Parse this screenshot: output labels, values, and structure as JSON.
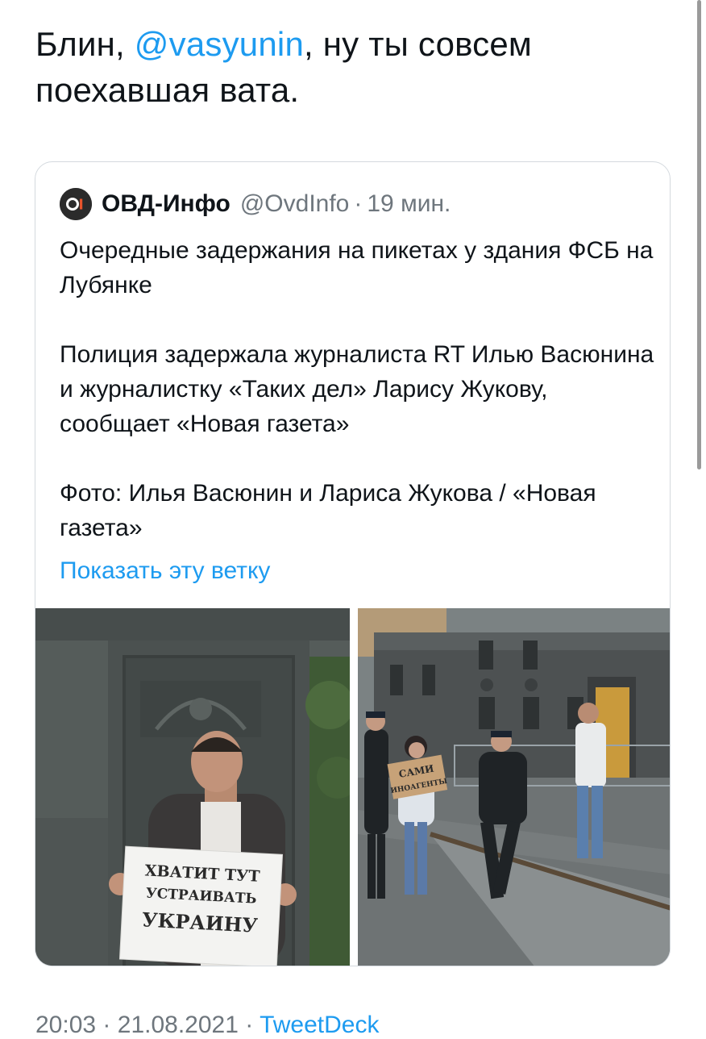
{
  "tweet": {
    "text_before": "Блин, ",
    "mention": "@vasyunin",
    "text_after": ", ну ты совсем поехавшая вата."
  },
  "quoted_tweet": {
    "avatar_text": "OI",
    "author_name": "ОВД-Инфо",
    "handle": "@OvdInfo",
    "separator": "·",
    "time_ago": "19 мин.",
    "body": "Очередные задержания на пикетах у здания ФСБ на Лубянке\n\nПолиция задержала журналиста RT Илью Васюнина и журналистку «Таких дел» Ларису Жукову, сообщает «Новая газета»\n\nФото: Илья Васюнин и Лариса Жукова / «Новая газета»",
    "show_thread": "Показать эту ветку",
    "photos": {
      "left_sign": [
        "ХВАТИТ ТУТ",
        "УСТРАИВАТЬ",
        "УКРАИНУ"
      ],
      "right_sign": [
        "САМИ",
        "ИНОАГЕНТЫ"
      ]
    }
  },
  "footer": {
    "time": "20:03",
    "sep1": "·",
    "date": "21.08.2021",
    "sep2": "·",
    "source": "TweetDeck"
  },
  "colors": {
    "link": "#1d9bf0",
    "text": "#0f1419",
    "muted": "#6e767d",
    "border": "#d4d9de"
  }
}
